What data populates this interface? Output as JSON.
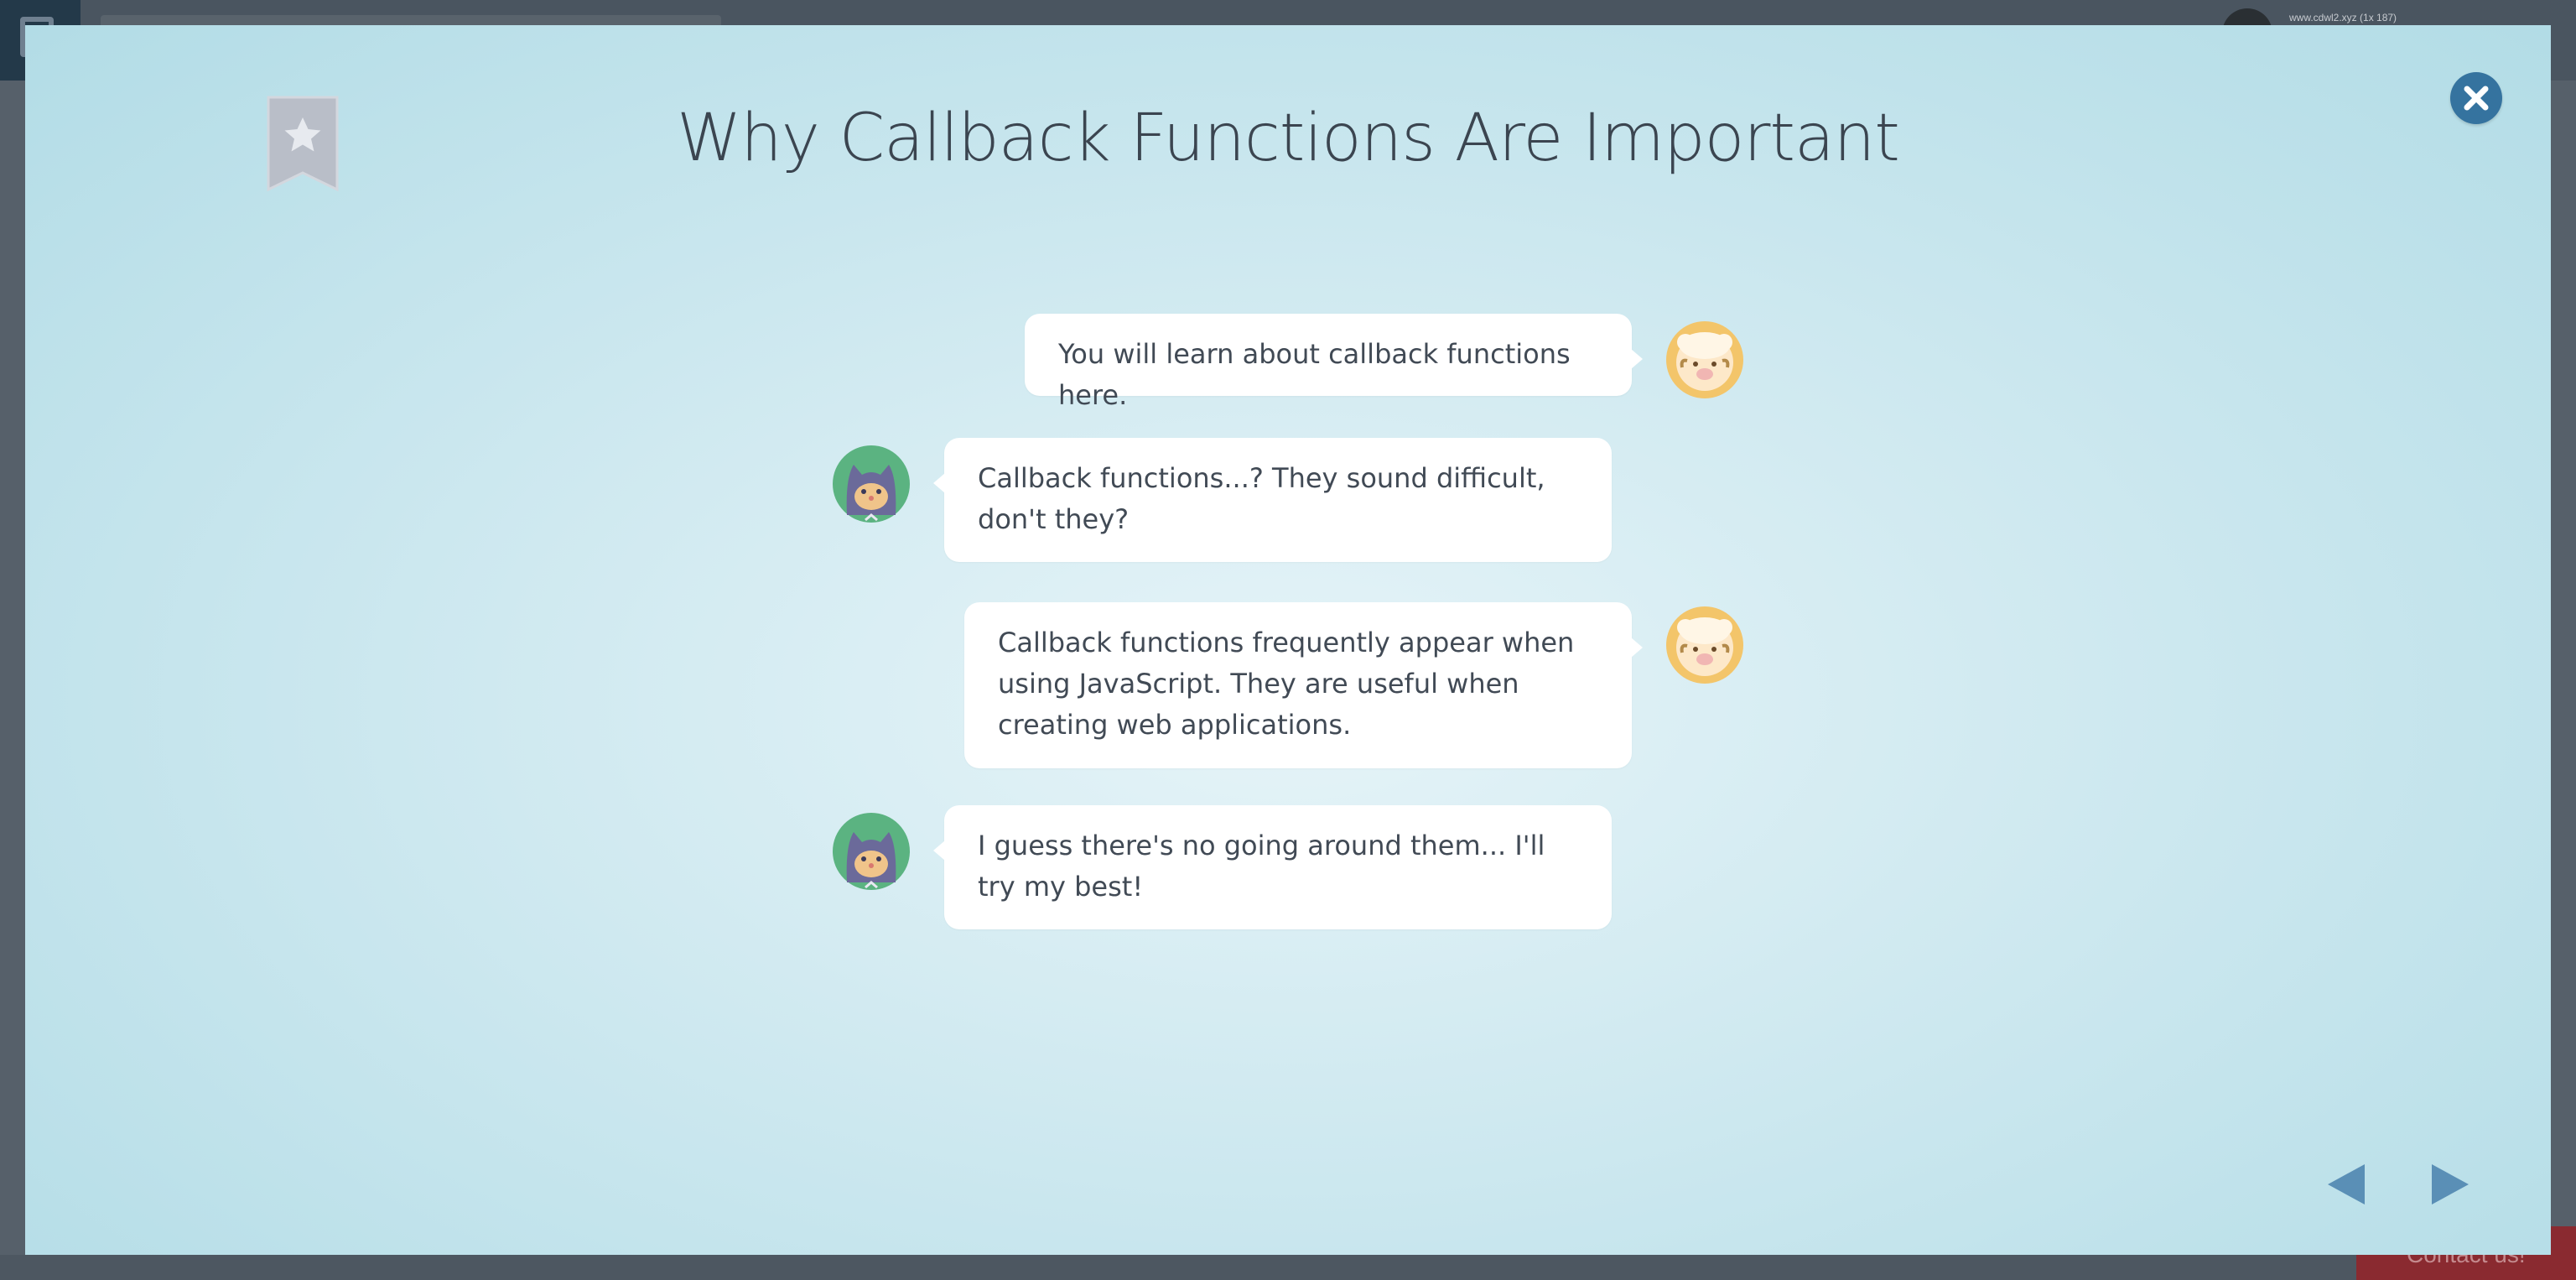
{
  "background": {
    "user_label": "www.cdwl2.xyz (1x 187)",
    "contact_label": "Contact us!"
  },
  "modal": {
    "title": "Why Callback Functions Are Important",
    "bookmark_icon": "bookmark-star-icon",
    "close_icon": "close-icon",
    "colors": {
      "close_button": "#35739f",
      "nav_arrow": "#5a8fb6",
      "bookmark": "#b9bec8"
    }
  },
  "chat": [
    {
      "speaker": "sheep",
      "side": "right",
      "text": "You will learn about callback functions here."
    },
    {
      "speaker": "cat",
      "side": "left",
      "text": "Callback functions...? They sound difficult, don't they?"
    },
    {
      "speaker": "sheep",
      "side": "right",
      "text": "Callback functions frequently appear when using JavaScript. They are useful when creating web applications."
    },
    {
      "speaker": "cat",
      "side": "left",
      "text": "I guess there's no going around them... I'll try my best!"
    }
  ],
  "nav": {
    "prev_icon": "triangle-left-icon",
    "next_icon": "triangle-right-icon"
  }
}
